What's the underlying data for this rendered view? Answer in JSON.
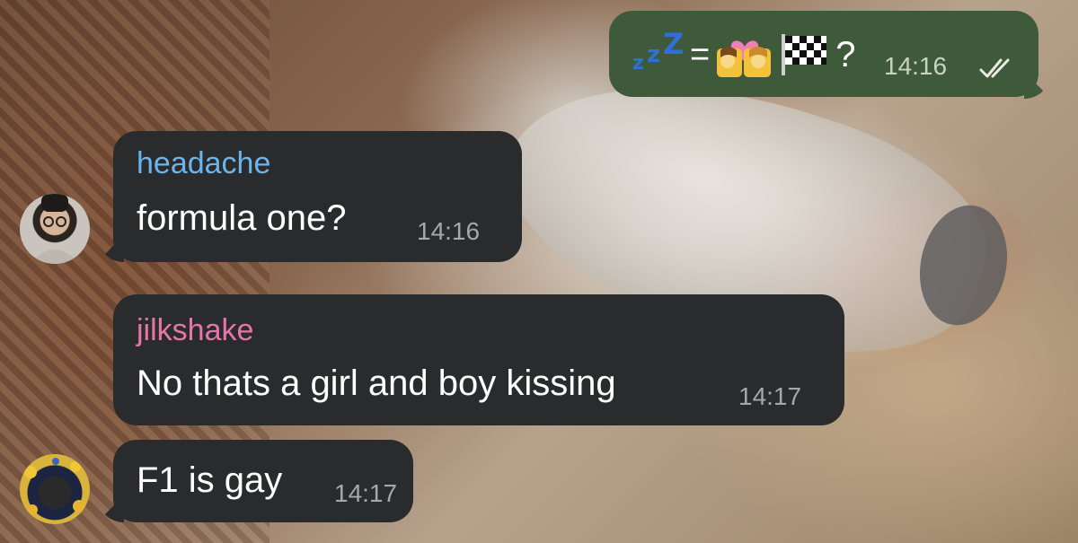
{
  "chat": {
    "outgoing": {
      "emoji_icons": [
        "zzz-icon",
        "equals-sign",
        "kiss-icon",
        "checkered-flag-icon"
      ],
      "equals": "=",
      "question_mark": "?",
      "time": "14:16",
      "status_icon": "double-check-icon"
    },
    "messages": [
      {
        "sender": "headache",
        "sender_color": "#6cb4ec",
        "text": "formula one?",
        "time": "14:16",
        "avatar_icon": "avatar-headache"
      },
      {
        "sender": "jilkshake",
        "sender_color": "#e776a8",
        "text": "No thats a girl and boy kissing",
        "time": "14:17"
      },
      {
        "text": "F1 is gay",
        "time": "14:17",
        "avatar_icon": "avatar-jilkshake"
      }
    ]
  },
  "colors": {
    "incoming_bubble": "#2a2b2c",
    "outgoing_bubble": "#3f5a3a",
    "timestamp": "#a5a8ab",
    "zzz": "#2f6fd6"
  }
}
